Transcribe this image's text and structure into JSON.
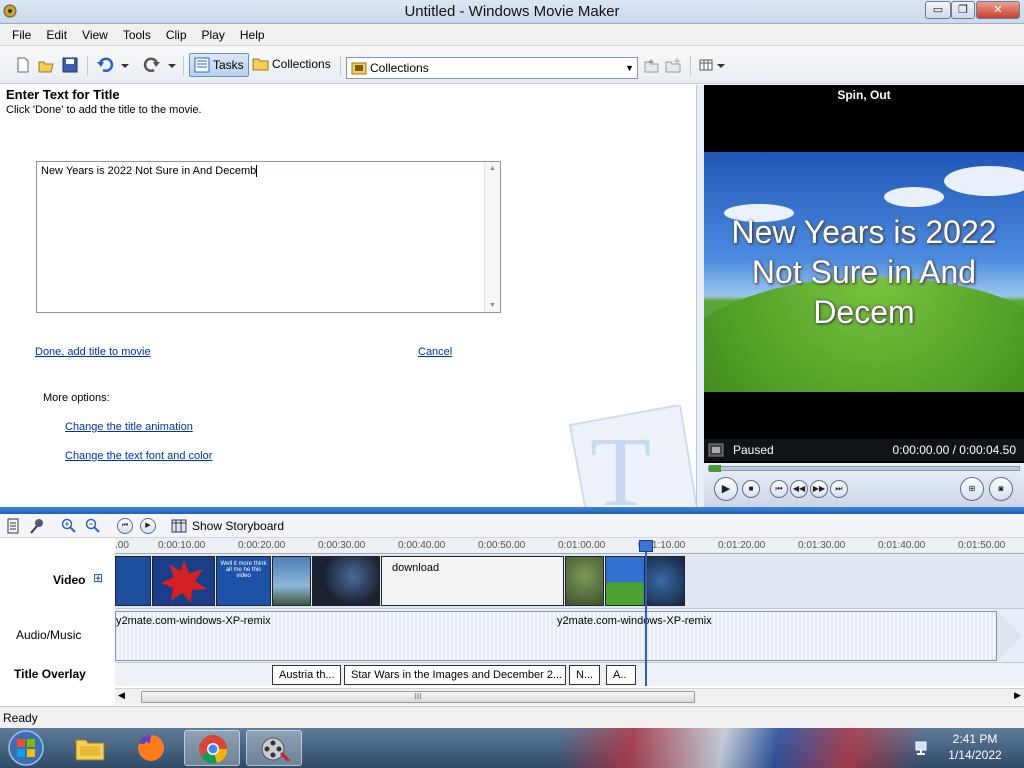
{
  "window": {
    "title": "Untitled - Windows Movie Maker",
    "minimize": "▭",
    "maximize": "❐",
    "close": "✕"
  },
  "menu": [
    "File",
    "Edit",
    "View",
    "Tools",
    "Clip",
    "Play",
    "Help"
  ],
  "toolbar": {
    "tasks_label": "Tasks",
    "collections_label": "Collections",
    "collections_dropdown": "Collections"
  },
  "task_pane": {
    "heading": "Enter Text for Title",
    "subheading": "Click 'Done' to add the title to the movie.",
    "title_text_value": "New Years is 2022 Not Sure in And Decemb",
    "done_link": "Done, add title to movie",
    "cancel_link": "Cancel",
    "more_options_label": "More options:",
    "options": [
      "Change the title animation",
      "Change the text font and color"
    ]
  },
  "preview": {
    "animation_name": "Spin, Out",
    "caption": "New Years is 2022 Not Sure in And Decem",
    "status": "Paused",
    "time": "0:00:00.00 / 0:00:04.50"
  },
  "timeline": {
    "show_storyboard_label": "Show Storyboard",
    "ruler_ticks": [
      ".00",
      "0:00:10.00",
      "0:00:20.00",
      "0:00:30.00",
      "0:00:40.00",
      "0:00:50.00",
      "0:01:00.00",
      "0:01:10.00",
      "0:01:20.00",
      "0:01:30.00",
      "0:01:40.00",
      "0:01:50.00"
    ],
    "track_labels": {
      "video": "Video",
      "video_expand": "⊞",
      "audio": "Audio/Music",
      "overlay": "Title Overlay"
    },
    "video_clips": [
      {
        "label": "",
        "color": "#1c4f9c"
      },
      {
        "label": "",
        "color": "#1a3d8a"
      },
      {
        "label": "Well it more think all me he this video",
        "color": "#1d52a8"
      },
      {
        "label": "",
        "color": "#4d7fb4"
      },
      {
        "label": "",
        "color": "#1b2230"
      },
      {
        "label": "download",
        "color": "#f4f4f4"
      },
      {
        "label": "",
        "color": "#3d5128"
      },
      {
        "label": "",
        "color": "#2f71d0"
      },
      {
        "label": "",
        "color": "#15243a"
      }
    ],
    "audio_clip_labels": [
      "y2mate.com-windows-XP-remix",
      "y2mate.com-windows-XP-remix"
    ],
    "overlay_clips": [
      "Austria th...",
      "Star Wars in the Images and December 2...",
      "N...",
      "A.."
    ],
    "scroll_grip": "III"
  },
  "status_bar": {
    "text": "Ready"
  },
  "taskbar": {
    "clock_time": "2:41 PM",
    "clock_date": "1/14/2022"
  },
  "colors": {
    "accent": "#1c63b8",
    "link": "#0033aa",
    "preview_bg": "#000000"
  }
}
